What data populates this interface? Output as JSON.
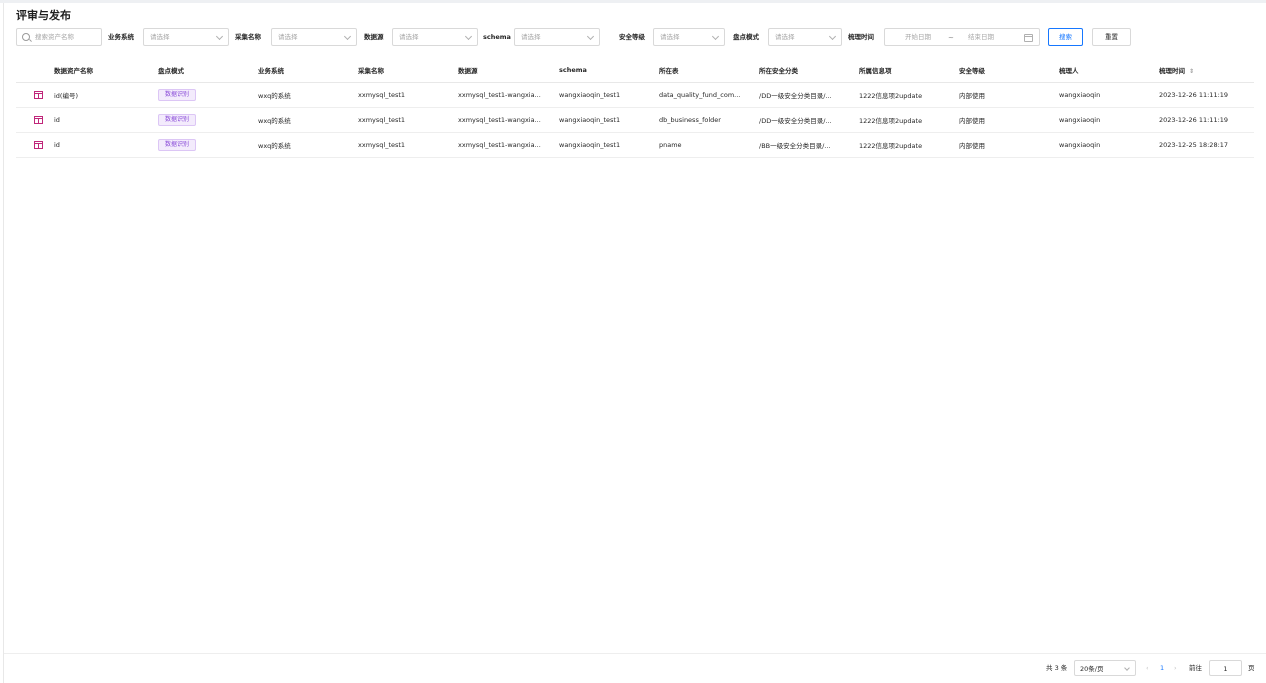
{
  "page": {
    "title": "评审与发布"
  },
  "filters": {
    "search_placeholder": "搜索资产名称",
    "business_system": {
      "label": "业务系统",
      "placeholder": "请选择"
    },
    "collect_name": {
      "label": "采集名称",
      "placeholder": "请选择"
    },
    "datasource": {
      "label": "数据源",
      "placeholder": "请选择"
    },
    "schema": {
      "label": "schema",
      "placeholder": "请选择"
    },
    "security_level": {
      "label": "安全等级",
      "placeholder": "请选择"
    },
    "inventory_mode": {
      "label": "盘点模式",
      "placeholder": "请选择"
    },
    "sort_time": {
      "label": "梳理时间",
      "start_placeholder": "开始日期",
      "separator": "~",
      "end_placeholder": "结束日期"
    },
    "search_button": "搜索",
    "reset_button": "重置"
  },
  "table": {
    "columns": [
      "数据资产名称",
      "盘点模式",
      "业务系统",
      "采集名称",
      "数据源",
      "schema",
      "所在表",
      "所在安全分类",
      "所属信息项",
      "安全等级",
      "梳理人",
      "梳理时间"
    ],
    "rows": [
      {
        "name": "id(编号)",
        "mode": "数据识别",
        "system": "wxq的系统",
        "collect": "xxmysql_test1",
        "datasource": "xxmysql_test1-wangxia...",
        "schema": "wangxiaoqin_test1",
        "table": "data_quality_fund_com...",
        "category": "/DD一级安全分类目录/...",
        "info_item": "1222信息项2update",
        "level": "内部使用",
        "owner": "wangxiaoqin",
        "time": "2023-12-26 11:11:19"
      },
      {
        "name": "id",
        "mode": "数据识别",
        "system": "wxq的系统",
        "collect": "xxmysql_test1",
        "datasource": "xxmysql_test1-wangxia...",
        "schema": "wangxiaoqin_test1",
        "table": "db_business_folder",
        "category": "/DD一级安全分类目录/...",
        "info_item": "1222信息项2update",
        "level": "内部使用",
        "owner": "wangxiaoqin",
        "time": "2023-12-26 11:11:19"
      },
      {
        "name": "id",
        "mode": "数据识别",
        "system": "wxq的系统",
        "collect": "xxmysql_test1",
        "datasource": "xxmysql_test1-wangxia...",
        "schema": "wangxiaoqin_test1",
        "table": "pname",
        "category": "/BB一级安全分类目录/...",
        "info_item": "1222信息项2update",
        "level": "内部使用",
        "owner": "wangxiaoqin",
        "time": "2023-12-25 18:28:17"
      }
    ]
  },
  "pagination": {
    "total": "共 3 条",
    "page_size": "20条/页",
    "current_page": "1",
    "goto_label": "前往",
    "goto_value": "1",
    "page_suffix": "页"
  },
  "colors": {
    "primary": "#1677ff",
    "tag_text": "#8a4bd8",
    "tag_bg": "#f3ebfc",
    "table_icon": "#c0267a"
  },
  "icons": {
    "search": "search-icon",
    "table": "table-icon",
    "calendar": "calendar-icon",
    "dropdown": "chevron-down-icon",
    "sort": "sort-icon"
  }
}
